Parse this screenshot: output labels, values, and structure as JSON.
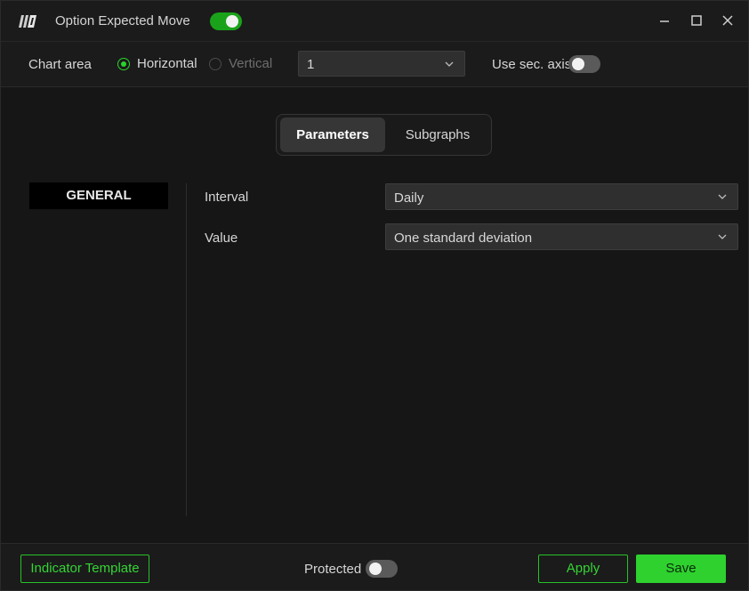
{
  "window": {
    "title": "Option Expected Move",
    "enabled": true,
    "controls": [
      "minimize-icon",
      "maximize-icon",
      "close-icon"
    ]
  },
  "chart_area": {
    "label": "Chart area",
    "orientation_options": [
      {
        "label": "Horizontal",
        "selected": true
      },
      {
        "label": "Vertical",
        "selected": false
      }
    ],
    "area_select_value": "1",
    "sec_axis_label": "Use sec. axis",
    "sec_axis_enabled": false
  },
  "tabs": [
    {
      "label": "Parameters",
      "active": true
    },
    {
      "label": "Subgraphs",
      "active": false
    }
  ],
  "nav": {
    "general_label": "GENERAL"
  },
  "parameters": [
    {
      "label": "Interval",
      "value": "Daily"
    },
    {
      "label": "Value",
      "value": "One standard deviation"
    }
  ],
  "footer": {
    "template_label": "Indicator Template",
    "protected_label": "Protected",
    "protected_enabled": false,
    "apply_label": "Apply",
    "save_label": "Save"
  },
  "colors": {
    "accent_green": "#29d429",
    "toggle_on": "#1aa31a",
    "background": "#161616"
  }
}
